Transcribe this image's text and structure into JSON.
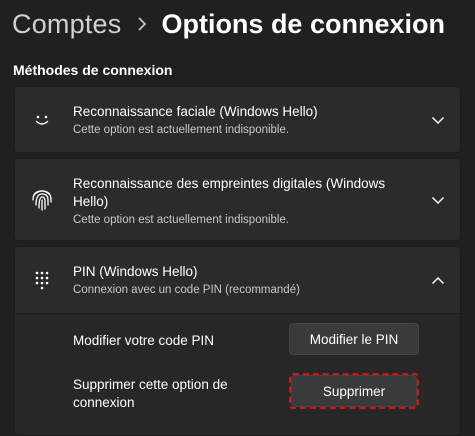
{
  "header": {
    "parent": "Comptes",
    "current": "Options de connexion"
  },
  "section_title": "Méthodes de connexion",
  "methods": [
    {
      "title": "Reconnaissance faciale (Windows Hello)",
      "subtitle": "Cette option est actuellement indisponible.",
      "icon": "face-smile-icon",
      "expanded": false
    },
    {
      "title": "Reconnaissance des empreintes digitales (Windows Hello)",
      "subtitle": "Cette option est actuellement indisponible.",
      "icon": "fingerprint-icon",
      "expanded": false
    },
    {
      "title": "PIN (Windows Hello)",
      "subtitle": "Connexion avec un code PIN (recommandé)",
      "icon": "keypad-icon",
      "expanded": true,
      "settings": [
        {
          "label": "Modifier votre code PIN",
          "button": "Modifier le PIN"
        },
        {
          "label": "Supprimer cette option de connexion",
          "button": "Supprimer"
        }
      ]
    }
  ],
  "colors": {
    "background": "#202020",
    "card": "#2b2b2b",
    "button": "#3a3a3a",
    "highlight_border": "#e01010"
  }
}
